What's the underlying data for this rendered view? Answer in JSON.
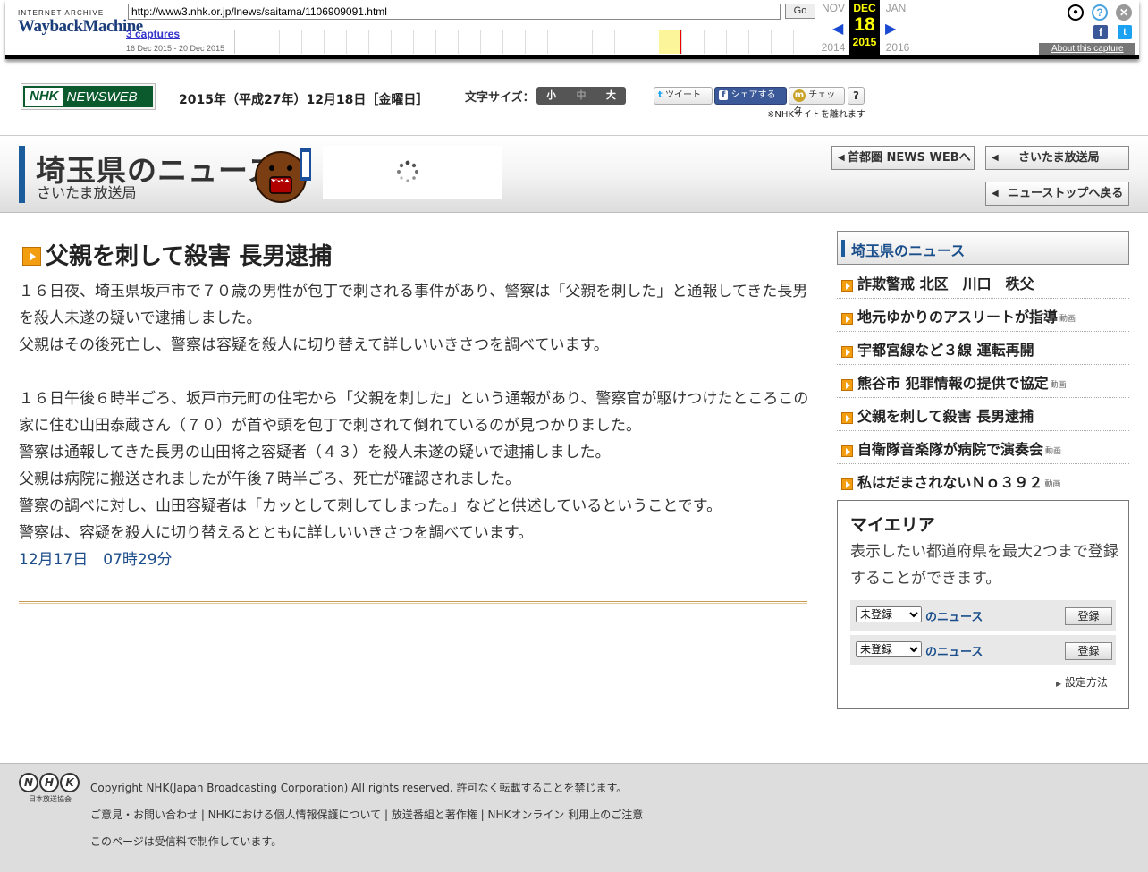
{
  "wayback": {
    "logo_top": "INTERNET ARCHIVE",
    "logo_main": "WaybackMachine",
    "url": "http://www3.nhk.or.jp/lnews/saitama/1106909091.html",
    "go_label": "Go",
    "captures": "3 captures",
    "range": "16 Dec 2015 - 20 Dec 2015",
    "prev_month": "NOV",
    "cur_month": "DEC",
    "next_month": "JAN",
    "prev_year": "2014",
    "cur_day": "18",
    "cur_year": "2015",
    "next_year": "2016",
    "about": "About this capture"
  },
  "header": {
    "logo_nhk": "NHK",
    "logo_news": "NEWSWEB",
    "date": "2015年（平成27年）12月18日［金曜日］",
    "font_size_label": "文字サイズ：",
    "font_sizes": [
      "小",
      "中",
      "大"
    ],
    "tweet": "ツイート",
    "share": "シェアする",
    "check": "チェック",
    "help": "?",
    "external_note": "※NHKサイトを離れます"
  },
  "prefecture": {
    "title": "埼玉県のニュース",
    "subtitle": "さいたま放送局",
    "btn_metro": "首都圏 NEWS WEBへ",
    "btn_station": "さいたま放送局",
    "btn_top": "ニューストップへ戻る"
  },
  "article": {
    "title": "父親を刺して殺害 長男逮捕",
    "para1": "１６日夜、埼玉県坂戸市で７０歳の男性が包丁で刺される事件があり、警察は「父親を刺した」と通報してきた長男を殺人未遂の疑いで逮捕しました。",
    "para2": "父親はその後死亡し、警察は容疑を殺人に切り替えて詳しいいきさつを調べています。",
    "para3": "１６日午後６時半ごろ、坂戸市元町の住宅から「父親を刺した」という通報があり、警察官が駆けつけたところこの家に住む山田泰蔵さん（７０）が首や頭を包丁で刺されて倒れているのが見つかりました。",
    "para4": "警察は通報してきた長男の山田将之容疑者（４３）を殺人未遂の疑いで逮捕しました。",
    "para5": "父親は病院に搬送されましたが午後７時半ごろ、死亡が確認されました。",
    "para6": "警察の調べに対し、山田容疑者は「カッとして刺してしまった。」などと供述しているということです。",
    "para7": "警察は、容疑を殺人に切り替えるとともに詳しいいきさつを調べています。",
    "timestamp": "12月17日　07時29分"
  },
  "sidebar": {
    "heading": "埼玉県のニュース",
    "items": [
      {
        "label": "詐欺警戒 北区　川口　秩父",
        "video": ""
      },
      {
        "label": "地元ゆかりのアスリートが指導",
        "video": "動画"
      },
      {
        "label": "宇都宮線など３線 運転再開",
        "video": ""
      },
      {
        "label": "熊谷市 犯罪情報の提供で協定",
        "video": "動画"
      },
      {
        "label": "父親を刺して殺害 長男逮捕",
        "video": ""
      },
      {
        "label": "自衛隊音楽隊が病院で演奏会",
        "video": "動画"
      },
      {
        "label": "私はだまされないＮｏ３９２",
        "video": "動画"
      }
    ],
    "myarea": {
      "heading": "マイエリア",
      "desc": "表示したい都道府県を最大2つまで登録することができます。",
      "select_value": "未登録",
      "news_label": "のニュース",
      "register": "登録",
      "howto": "設定方法"
    }
  },
  "footer": {
    "logo_jp": "日本放送協会",
    "copyright": "Copyright NHK(Japan Broadcasting Corporation) All rights reserved. 許可なく転載することを禁じます。",
    "links": "ご意見・お問い合わせ | NHKにおける個人情報保護について | 放送番組と著作権 | NHKオンライン 利用上のご注意",
    "fee_note": "このページは受信料で制作しています。"
  }
}
